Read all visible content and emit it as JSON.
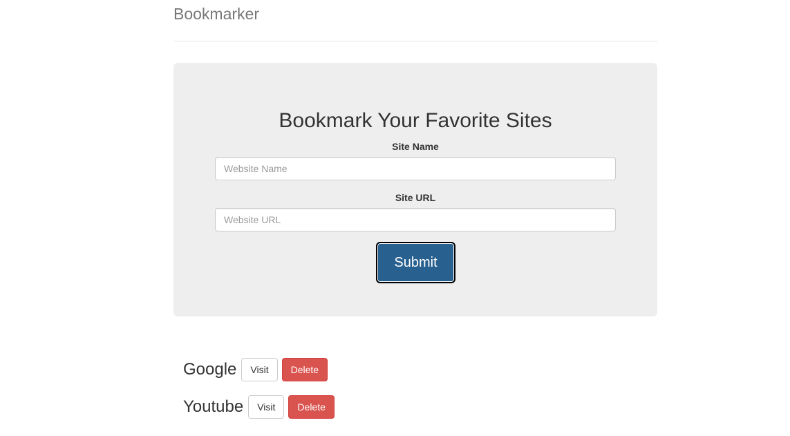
{
  "header": {
    "brand": "Bookmarker"
  },
  "form": {
    "title": "Bookmark Your Favorite Sites",
    "site_name_label": "Site Name",
    "site_name_placeholder": "Website Name",
    "site_name_value": "",
    "site_url_label": "Site URL",
    "site_url_placeholder": "Website URL",
    "site_url_value": "",
    "submit_label": "Submit"
  },
  "bookmarks": [
    {
      "name": "Google",
      "visit_label": "Visit",
      "delete_label": "Delete"
    },
    {
      "name": "Youtube",
      "visit_label": "Visit",
      "delete_label": "Delete"
    }
  ],
  "colors": {
    "primary": "#286090",
    "danger": "#d9534f",
    "jumbotron_bg": "#eeeeee",
    "brand_text": "#777777"
  }
}
